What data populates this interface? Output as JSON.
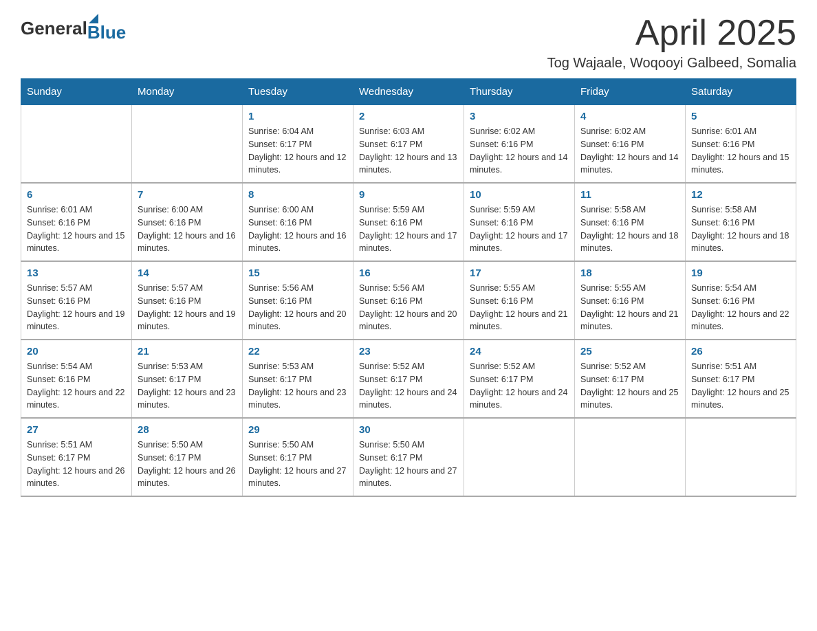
{
  "header": {
    "logo_general": "General",
    "logo_blue": "Blue",
    "title": "April 2025",
    "subtitle": "Tog Wajaale, Woqooyi Galbeed, Somalia"
  },
  "weekdays": [
    "Sunday",
    "Monday",
    "Tuesday",
    "Wednesday",
    "Thursday",
    "Friday",
    "Saturday"
  ],
  "weeks": [
    [
      {
        "day": "",
        "sunrise": "",
        "sunset": "",
        "daylight": ""
      },
      {
        "day": "",
        "sunrise": "",
        "sunset": "",
        "daylight": ""
      },
      {
        "day": "1",
        "sunrise": "Sunrise: 6:04 AM",
        "sunset": "Sunset: 6:17 PM",
        "daylight": "Daylight: 12 hours and 12 minutes."
      },
      {
        "day": "2",
        "sunrise": "Sunrise: 6:03 AM",
        "sunset": "Sunset: 6:17 PM",
        "daylight": "Daylight: 12 hours and 13 minutes."
      },
      {
        "day": "3",
        "sunrise": "Sunrise: 6:02 AM",
        "sunset": "Sunset: 6:16 PM",
        "daylight": "Daylight: 12 hours and 14 minutes."
      },
      {
        "day": "4",
        "sunrise": "Sunrise: 6:02 AM",
        "sunset": "Sunset: 6:16 PM",
        "daylight": "Daylight: 12 hours and 14 minutes."
      },
      {
        "day": "5",
        "sunrise": "Sunrise: 6:01 AM",
        "sunset": "Sunset: 6:16 PM",
        "daylight": "Daylight: 12 hours and 15 minutes."
      }
    ],
    [
      {
        "day": "6",
        "sunrise": "Sunrise: 6:01 AM",
        "sunset": "Sunset: 6:16 PM",
        "daylight": "Daylight: 12 hours and 15 minutes."
      },
      {
        "day": "7",
        "sunrise": "Sunrise: 6:00 AM",
        "sunset": "Sunset: 6:16 PM",
        "daylight": "Daylight: 12 hours and 16 minutes."
      },
      {
        "day": "8",
        "sunrise": "Sunrise: 6:00 AM",
        "sunset": "Sunset: 6:16 PM",
        "daylight": "Daylight: 12 hours and 16 minutes."
      },
      {
        "day": "9",
        "sunrise": "Sunrise: 5:59 AM",
        "sunset": "Sunset: 6:16 PM",
        "daylight": "Daylight: 12 hours and 17 minutes."
      },
      {
        "day": "10",
        "sunrise": "Sunrise: 5:59 AM",
        "sunset": "Sunset: 6:16 PM",
        "daylight": "Daylight: 12 hours and 17 minutes."
      },
      {
        "day": "11",
        "sunrise": "Sunrise: 5:58 AM",
        "sunset": "Sunset: 6:16 PM",
        "daylight": "Daylight: 12 hours and 18 minutes."
      },
      {
        "day": "12",
        "sunrise": "Sunrise: 5:58 AM",
        "sunset": "Sunset: 6:16 PM",
        "daylight": "Daylight: 12 hours and 18 minutes."
      }
    ],
    [
      {
        "day": "13",
        "sunrise": "Sunrise: 5:57 AM",
        "sunset": "Sunset: 6:16 PM",
        "daylight": "Daylight: 12 hours and 19 minutes."
      },
      {
        "day": "14",
        "sunrise": "Sunrise: 5:57 AM",
        "sunset": "Sunset: 6:16 PM",
        "daylight": "Daylight: 12 hours and 19 minutes."
      },
      {
        "day": "15",
        "sunrise": "Sunrise: 5:56 AM",
        "sunset": "Sunset: 6:16 PM",
        "daylight": "Daylight: 12 hours and 20 minutes."
      },
      {
        "day": "16",
        "sunrise": "Sunrise: 5:56 AM",
        "sunset": "Sunset: 6:16 PM",
        "daylight": "Daylight: 12 hours and 20 minutes."
      },
      {
        "day": "17",
        "sunrise": "Sunrise: 5:55 AM",
        "sunset": "Sunset: 6:16 PM",
        "daylight": "Daylight: 12 hours and 21 minutes."
      },
      {
        "day": "18",
        "sunrise": "Sunrise: 5:55 AM",
        "sunset": "Sunset: 6:16 PM",
        "daylight": "Daylight: 12 hours and 21 minutes."
      },
      {
        "day": "19",
        "sunrise": "Sunrise: 5:54 AM",
        "sunset": "Sunset: 6:16 PM",
        "daylight": "Daylight: 12 hours and 22 minutes."
      }
    ],
    [
      {
        "day": "20",
        "sunrise": "Sunrise: 5:54 AM",
        "sunset": "Sunset: 6:16 PM",
        "daylight": "Daylight: 12 hours and 22 minutes."
      },
      {
        "day": "21",
        "sunrise": "Sunrise: 5:53 AM",
        "sunset": "Sunset: 6:17 PM",
        "daylight": "Daylight: 12 hours and 23 minutes."
      },
      {
        "day": "22",
        "sunrise": "Sunrise: 5:53 AM",
        "sunset": "Sunset: 6:17 PM",
        "daylight": "Daylight: 12 hours and 23 minutes."
      },
      {
        "day": "23",
        "sunrise": "Sunrise: 5:52 AM",
        "sunset": "Sunset: 6:17 PM",
        "daylight": "Daylight: 12 hours and 24 minutes."
      },
      {
        "day": "24",
        "sunrise": "Sunrise: 5:52 AM",
        "sunset": "Sunset: 6:17 PM",
        "daylight": "Daylight: 12 hours and 24 minutes."
      },
      {
        "day": "25",
        "sunrise": "Sunrise: 5:52 AM",
        "sunset": "Sunset: 6:17 PM",
        "daylight": "Daylight: 12 hours and 25 minutes."
      },
      {
        "day": "26",
        "sunrise": "Sunrise: 5:51 AM",
        "sunset": "Sunset: 6:17 PM",
        "daylight": "Daylight: 12 hours and 25 minutes."
      }
    ],
    [
      {
        "day": "27",
        "sunrise": "Sunrise: 5:51 AM",
        "sunset": "Sunset: 6:17 PM",
        "daylight": "Daylight: 12 hours and 26 minutes."
      },
      {
        "day": "28",
        "sunrise": "Sunrise: 5:50 AM",
        "sunset": "Sunset: 6:17 PM",
        "daylight": "Daylight: 12 hours and 26 minutes."
      },
      {
        "day": "29",
        "sunrise": "Sunrise: 5:50 AM",
        "sunset": "Sunset: 6:17 PM",
        "daylight": "Daylight: 12 hours and 27 minutes."
      },
      {
        "day": "30",
        "sunrise": "Sunrise: 5:50 AM",
        "sunset": "Sunset: 6:17 PM",
        "daylight": "Daylight: 12 hours and 27 minutes."
      },
      {
        "day": "",
        "sunrise": "",
        "sunset": "",
        "daylight": ""
      },
      {
        "day": "",
        "sunrise": "",
        "sunset": "",
        "daylight": ""
      },
      {
        "day": "",
        "sunrise": "",
        "sunset": "",
        "daylight": ""
      }
    ]
  ]
}
